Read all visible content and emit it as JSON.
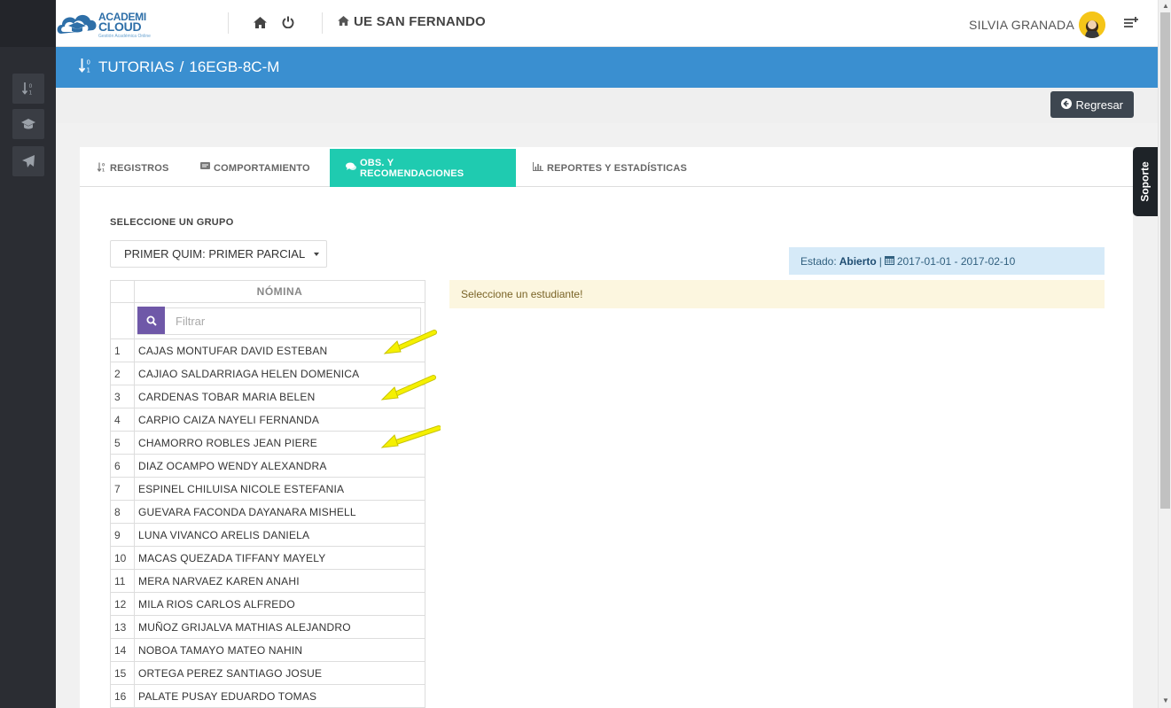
{
  "header": {
    "logo": {
      "line1": "ACADEMI",
      "line2": "CLOUD",
      "tagline": "Gestión Académica Online"
    },
    "school": "UE SAN FERNANDO",
    "user": "SILVIA GRANADA",
    "icons": [
      "home-icon",
      "power-icon",
      "home-small-icon",
      "list-add-icon"
    ]
  },
  "sidebar": {
    "items": [
      {
        "name": "sort-numeric-icon"
      },
      {
        "name": "graduation-cap-icon"
      },
      {
        "name": "paper-plane-icon"
      }
    ]
  },
  "banner": {
    "section": "TUTORIAS",
    "separator": "/",
    "course": "16EGB-8C-M"
  },
  "actions": {
    "back_label": "Regresar"
  },
  "tabs": [
    {
      "label": "REGISTROS",
      "icon": "sort-numeric-icon",
      "active": false
    },
    {
      "label": "COMPORTAMIENTO",
      "icon": "comment-box-icon",
      "active": false
    },
    {
      "label": "OBS. Y RECOMENDACIONES",
      "icon": "comments-icon",
      "active": true
    },
    {
      "label": "REPORTES Y ESTADÍSTICAS",
      "icon": "bar-chart-icon",
      "active": false
    }
  ],
  "group": {
    "label": "SELECCIONE UN GRUPO",
    "selected": "PRIMER QUIM: PRIMER PARCIAL"
  },
  "estado": {
    "prefix": "Estado:",
    "value": "Abierto",
    "separator": "|",
    "range": "2017-01-01 - 2017-02-10"
  },
  "message": "Seleccione un estudiante!",
  "roster": {
    "header": "NÓMINA",
    "filter_placeholder": "Filtrar",
    "students": [
      {
        "n": "1",
        "name": "CAJAS MONTUFAR DAVID ESTEBAN"
      },
      {
        "n": "2",
        "name": "CAJIAO SALDARRIAGA HELEN DOMENICA"
      },
      {
        "n": "3",
        "name": "CARDENAS TOBAR MARIA BELEN"
      },
      {
        "n": "4",
        "name": "CARPIO CAIZA NAYELI FERNANDA"
      },
      {
        "n": "5",
        "name": "CHAMORRO ROBLES JEAN PIERE"
      },
      {
        "n": "6",
        "name": "DIAZ OCAMPO WENDY ALEXANDRA"
      },
      {
        "n": "7",
        "name": "ESPINEL CHILUISA NICOLE ESTEFANIA"
      },
      {
        "n": "8",
        "name": "GUEVARA FACONDA DAYANARA MISHELL"
      },
      {
        "n": "9",
        "name": "LUNA VIVANCO ARELIS DANIELA"
      },
      {
        "n": "10",
        "name": "MACAS QUEZADA TIFFANY MAYELY"
      },
      {
        "n": "11",
        "name": "MERA NARVAEZ KAREN ANAHI"
      },
      {
        "n": "12",
        "name": "MILA RIOS CARLOS ALFREDO"
      },
      {
        "n": "13",
        "name": "MUÑOZ GRIJALVA MATHIAS ALEJANDRO"
      },
      {
        "n": "14",
        "name": "NOBOA TAMAYO MATEO NAHIN"
      },
      {
        "n": "15",
        "name": "ORTEGA PEREZ SANTIAGO JOSUE"
      },
      {
        "n": "16",
        "name": "PALATE PUSAY EDUARDO TOMAS"
      }
    ]
  },
  "support_tab": "Soporte",
  "colors": {
    "banner": "#3a8fd0",
    "active_tab": "#1fcbb0",
    "sidebar": "#2b2d33",
    "filter_button": "#6f58a8",
    "annotation_arrow": "#f5f000"
  }
}
